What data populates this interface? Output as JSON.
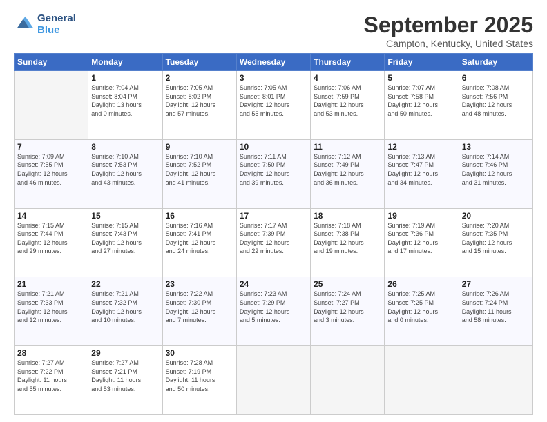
{
  "header": {
    "logo_line1": "General",
    "logo_line2": "Blue",
    "month": "September 2025",
    "location": "Campton, Kentucky, United States"
  },
  "weekdays": [
    "Sunday",
    "Monday",
    "Tuesday",
    "Wednesday",
    "Thursday",
    "Friday",
    "Saturday"
  ],
  "weeks": [
    [
      {
        "day": "",
        "detail": ""
      },
      {
        "day": "1",
        "detail": "Sunrise: 7:04 AM\nSunset: 8:04 PM\nDaylight: 13 hours\nand 0 minutes."
      },
      {
        "day": "2",
        "detail": "Sunrise: 7:05 AM\nSunset: 8:02 PM\nDaylight: 12 hours\nand 57 minutes."
      },
      {
        "day": "3",
        "detail": "Sunrise: 7:05 AM\nSunset: 8:01 PM\nDaylight: 12 hours\nand 55 minutes."
      },
      {
        "day": "4",
        "detail": "Sunrise: 7:06 AM\nSunset: 7:59 PM\nDaylight: 12 hours\nand 53 minutes."
      },
      {
        "day": "5",
        "detail": "Sunrise: 7:07 AM\nSunset: 7:58 PM\nDaylight: 12 hours\nand 50 minutes."
      },
      {
        "day": "6",
        "detail": "Sunrise: 7:08 AM\nSunset: 7:56 PM\nDaylight: 12 hours\nand 48 minutes."
      }
    ],
    [
      {
        "day": "7",
        "detail": "Sunrise: 7:09 AM\nSunset: 7:55 PM\nDaylight: 12 hours\nand 46 minutes."
      },
      {
        "day": "8",
        "detail": "Sunrise: 7:10 AM\nSunset: 7:53 PM\nDaylight: 12 hours\nand 43 minutes."
      },
      {
        "day": "9",
        "detail": "Sunrise: 7:10 AM\nSunset: 7:52 PM\nDaylight: 12 hours\nand 41 minutes."
      },
      {
        "day": "10",
        "detail": "Sunrise: 7:11 AM\nSunset: 7:50 PM\nDaylight: 12 hours\nand 39 minutes."
      },
      {
        "day": "11",
        "detail": "Sunrise: 7:12 AM\nSunset: 7:49 PM\nDaylight: 12 hours\nand 36 minutes."
      },
      {
        "day": "12",
        "detail": "Sunrise: 7:13 AM\nSunset: 7:47 PM\nDaylight: 12 hours\nand 34 minutes."
      },
      {
        "day": "13",
        "detail": "Sunrise: 7:14 AM\nSunset: 7:46 PM\nDaylight: 12 hours\nand 31 minutes."
      }
    ],
    [
      {
        "day": "14",
        "detail": "Sunrise: 7:15 AM\nSunset: 7:44 PM\nDaylight: 12 hours\nand 29 minutes."
      },
      {
        "day": "15",
        "detail": "Sunrise: 7:15 AM\nSunset: 7:43 PM\nDaylight: 12 hours\nand 27 minutes."
      },
      {
        "day": "16",
        "detail": "Sunrise: 7:16 AM\nSunset: 7:41 PM\nDaylight: 12 hours\nand 24 minutes."
      },
      {
        "day": "17",
        "detail": "Sunrise: 7:17 AM\nSunset: 7:39 PM\nDaylight: 12 hours\nand 22 minutes."
      },
      {
        "day": "18",
        "detail": "Sunrise: 7:18 AM\nSunset: 7:38 PM\nDaylight: 12 hours\nand 19 minutes."
      },
      {
        "day": "19",
        "detail": "Sunrise: 7:19 AM\nSunset: 7:36 PM\nDaylight: 12 hours\nand 17 minutes."
      },
      {
        "day": "20",
        "detail": "Sunrise: 7:20 AM\nSunset: 7:35 PM\nDaylight: 12 hours\nand 15 minutes."
      }
    ],
    [
      {
        "day": "21",
        "detail": "Sunrise: 7:21 AM\nSunset: 7:33 PM\nDaylight: 12 hours\nand 12 minutes."
      },
      {
        "day": "22",
        "detail": "Sunrise: 7:21 AM\nSunset: 7:32 PM\nDaylight: 12 hours\nand 10 minutes."
      },
      {
        "day": "23",
        "detail": "Sunrise: 7:22 AM\nSunset: 7:30 PM\nDaylight: 12 hours\nand 7 minutes."
      },
      {
        "day": "24",
        "detail": "Sunrise: 7:23 AM\nSunset: 7:29 PM\nDaylight: 12 hours\nand 5 minutes."
      },
      {
        "day": "25",
        "detail": "Sunrise: 7:24 AM\nSunset: 7:27 PM\nDaylight: 12 hours\nand 3 minutes."
      },
      {
        "day": "26",
        "detail": "Sunrise: 7:25 AM\nSunset: 7:25 PM\nDaylight: 12 hours\nand 0 minutes."
      },
      {
        "day": "27",
        "detail": "Sunrise: 7:26 AM\nSunset: 7:24 PM\nDaylight: 11 hours\nand 58 minutes."
      }
    ],
    [
      {
        "day": "28",
        "detail": "Sunrise: 7:27 AM\nSunset: 7:22 PM\nDaylight: 11 hours\nand 55 minutes."
      },
      {
        "day": "29",
        "detail": "Sunrise: 7:27 AM\nSunset: 7:21 PM\nDaylight: 11 hours\nand 53 minutes."
      },
      {
        "day": "30",
        "detail": "Sunrise: 7:28 AM\nSunset: 7:19 PM\nDaylight: 11 hours\nand 50 minutes."
      },
      {
        "day": "",
        "detail": ""
      },
      {
        "day": "",
        "detail": ""
      },
      {
        "day": "",
        "detail": ""
      },
      {
        "day": "",
        "detail": ""
      }
    ]
  ]
}
